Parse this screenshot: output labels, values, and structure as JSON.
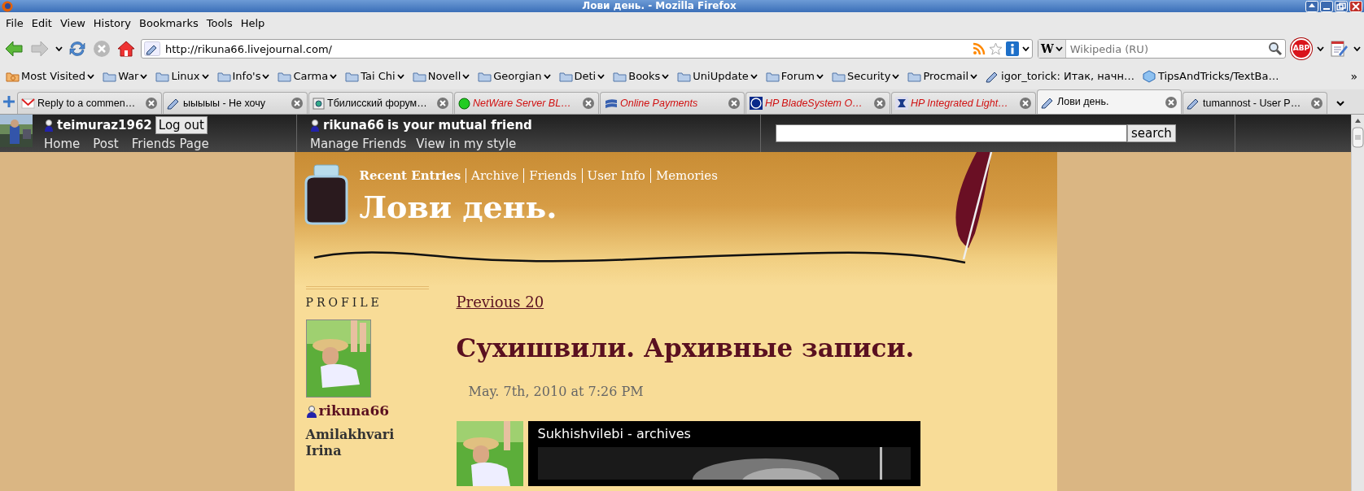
{
  "window": {
    "title": "Лови день. - Mozilla Firefox"
  },
  "menu": [
    "File",
    "Edit",
    "View",
    "History",
    "Bookmarks",
    "Tools",
    "Help"
  ],
  "navigation": {
    "back_disabled": false,
    "forward_disabled": true,
    "stop_disabled": true
  },
  "address": {
    "value": "http://rikuna66.livejournal.com/"
  },
  "search": {
    "engine": "W",
    "placeholder": "Wikipedia (RU)"
  },
  "adblock": {
    "label": "ABP"
  },
  "bookmarks": [
    {
      "label": "Most Visited",
      "kind": "smart"
    },
    {
      "label": "War",
      "kind": "folder"
    },
    {
      "label": "Linux",
      "kind": "folder"
    },
    {
      "label": "Info's",
      "kind": "folder"
    },
    {
      "label": "Carma",
      "kind": "folder"
    },
    {
      "label": "Tai Chi",
      "kind": "folder"
    },
    {
      "label": "Novell",
      "kind": "folder"
    },
    {
      "label": "Georgian",
      "kind": "folder"
    },
    {
      "label": "Deti",
      "kind": "folder"
    },
    {
      "label": "Books",
      "kind": "folder"
    },
    {
      "label": "UniUpdate",
      "kind": "folder"
    },
    {
      "label": "Forum",
      "kind": "folder"
    },
    {
      "label": "Security",
      "kind": "folder"
    },
    {
      "label": "Procmail",
      "kind": "folder"
    },
    {
      "label": "igor_torick: Итак, начн…",
      "kind": "pencil"
    },
    {
      "label": "TipsAndTricks/TextBa…",
      "kind": "cube"
    }
  ],
  "bookmarks_overflow": "»",
  "tabs": [
    {
      "label": "Reply to a commen…",
      "kind": "mail",
      "selected": false,
      "unread": false
    },
    {
      "label": "ыыыыы - Не хочу",
      "kind": "pencil",
      "selected": false,
      "unread": false
    },
    {
      "label": "Тбилисский форум…",
      "kind": "page",
      "selected": false,
      "unread": false
    },
    {
      "label": "NetWare Server BL…",
      "kind": "globe",
      "selected": false,
      "unread": true
    },
    {
      "label": "Online Payments",
      "kind": "card",
      "selected": false,
      "unread": true
    },
    {
      "label": "HP BladeSystem O…",
      "kind": "hp",
      "selected": false,
      "unread": true
    },
    {
      "label": "HP Integrated Light…",
      "kind": "server",
      "selected": false,
      "unread": true
    },
    {
      "label": "Лови день.",
      "kind": "pencil",
      "selected": true,
      "unread": false
    },
    {
      "label": "tumannost - User P…",
      "kind": "pencil",
      "selected": false,
      "unread": false
    }
  ],
  "lj_bar": {
    "user": "teimuraz1962",
    "logout": "Log out",
    "links": [
      "Home",
      "Post",
      "Friends Page"
    ],
    "friend_user": "rikuna66",
    "friend_status": "is your mutual friend",
    "friend_links": [
      "Manage Friends",
      "View in my style"
    ],
    "search_button": "search"
  },
  "journal": {
    "nav": [
      {
        "label": "Recent Entries",
        "selected": true
      },
      {
        "label": "Archive",
        "selected": false
      },
      {
        "label": "Friends",
        "selected": false
      },
      {
        "label": "User Info",
        "selected": false
      },
      {
        "label": "Memories",
        "selected": false
      }
    ],
    "title": "Лови день.",
    "sidebar": {
      "heading": "PROFILE",
      "user": "rikuna66",
      "name": "Amilakhvari Irina"
    },
    "previous": "Previous 20",
    "entry": {
      "title": "Сухишвили. Архивные записи.",
      "date": "May. 7th, 2010 at 7:26 PM",
      "video_title": "Sukhishvilebi - archives"
    }
  }
}
